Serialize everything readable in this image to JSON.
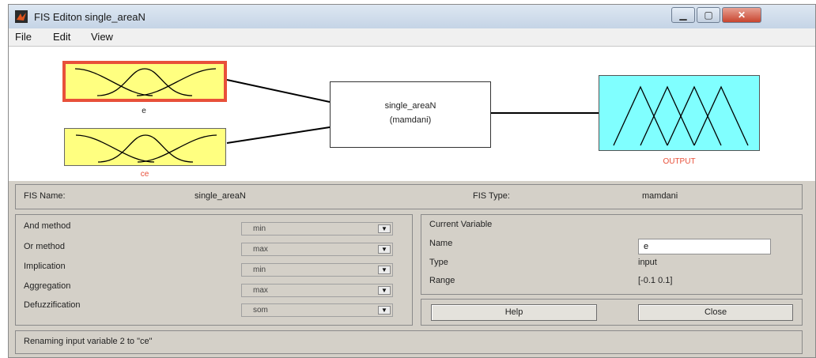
{
  "window": {
    "title": "FIS Editon single_areaN"
  },
  "menu": {
    "file": "File",
    "edit": "Edit",
    "view": "View"
  },
  "diagram": {
    "input1_label": "e",
    "input2_label": "ce",
    "system_name": "single_areaN",
    "system_type_paren": "(mamdani)",
    "output_label": "OUTPUT",
    "colors": {
      "input_fill": "#ffff80",
      "output_fill": "#80ffff",
      "selected_border": "#e8503a",
      "output_label": "#e8503a"
    }
  },
  "fis_info": {
    "name_label": "FIS Name:",
    "name_value": "single_areaN",
    "type_label": "FIS Type:",
    "type_value": "mamdani"
  },
  "methods": {
    "and_label": "And method",
    "and_value": "min",
    "or_label": "Or method",
    "or_value": "max",
    "implication_label": "Implication",
    "implication_value": "min",
    "aggregation_label": "Aggregation",
    "aggregation_value": "max",
    "defuzz_label": "Defuzzification",
    "defuzz_value": "som"
  },
  "current_variable": {
    "header": "Current Variable",
    "name_label": "Name",
    "name_value": "e",
    "type_label": "Type",
    "type_value": "input",
    "range_label": "Range",
    "range_value": "[-0.1 0.1]"
  },
  "buttons": {
    "help": "Help",
    "close": "Close"
  },
  "status": {
    "message": "Renaming input variable 2 to \"ce\""
  }
}
